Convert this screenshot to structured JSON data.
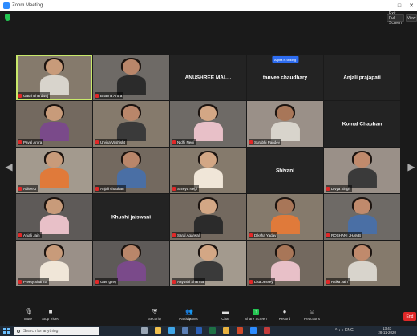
{
  "window": {
    "title": "Zoom Meeting",
    "controls": [
      "—",
      "□",
      "✕"
    ]
  },
  "top": {
    "exit_label": "Exit Full Screen",
    "view_label": "View"
  },
  "raise_hand_banner": "Arpita is talking",
  "participants": [
    {
      "name": "Gauri Bhardwaj",
      "video": true,
      "speaking": true
    },
    {
      "name": "Bhavna Arora",
      "video": true
    },
    {
      "name": "ANUSHREE MAL...",
      "video": false,
      "center": "ANUSHREE MAL..."
    },
    {
      "name": "tanvee chaudhary",
      "video": false,
      "center": "tanvee chaudhary"
    },
    {
      "name": "Anjali prajapati",
      "video": false,
      "center": "Anjali prajapati"
    },
    {
      "name": "Payal Arora",
      "video": true
    },
    {
      "name": "Urvika Vashisht",
      "video": true
    },
    {
      "name": "Nidhi Negi",
      "video": true
    },
    {
      "name": "Surabhi Pandey",
      "video": true
    },
    {
      "name": "Komal Chauhan",
      "video": false,
      "center": "Komal Chauhan"
    },
    {
      "name": "Aditee J",
      "video": true
    },
    {
      "name": "Anjali chauhan",
      "video": true
    },
    {
      "name": "Shreya Negi",
      "video": true
    },
    {
      "name": "Shivani",
      "video": false,
      "center": "Shivani"
    },
    {
      "name": "Divya Singh",
      "video": true
    },
    {
      "name": "Anjali Jain",
      "video": true
    },
    {
      "name": "Khushi jaiswani",
      "video": false,
      "center": "Khushi jaiswani"
    },
    {
      "name": "Saral Agarwal",
      "video": true
    },
    {
      "name": "Diksha Yadav",
      "video": true
    },
    {
      "name": "ROSHANI JHAMB",
      "video": true
    },
    {
      "name": "Preety Sharma",
      "video": true
    },
    {
      "name": "Gavi girey",
      "video": true
    },
    {
      "name": "Aayushi Sharma",
      "video": true
    },
    {
      "name": "Lisa Jessey",
      "video": true
    },
    {
      "name": "Ritika Jain",
      "video": true
    }
  ],
  "toolbar": [
    {
      "label": "Mute",
      "icon": "mic-icon"
    },
    {
      "label": "Stop Video",
      "icon": "video-icon"
    },
    {
      "label": "Security",
      "icon": "shield-icon"
    },
    {
      "label": "Participants",
      "icon": "participants-icon"
    },
    {
      "label": "Chat",
      "icon": "chat-icon"
    },
    {
      "label": "Share Screen",
      "icon": "share-icon"
    },
    {
      "label": "Record",
      "icon": "record-icon"
    },
    {
      "label": "Reactions",
      "icon": "reactions-icon"
    }
  ],
  "participants_count": "42",
  "end_label": "End",
  "taskbar": {
    "search_placeholder": "Search for anything",
    "time": "13:43",
    "date": "28-11-2020"
  },
  "colors": {
    "speaking_border": "#c8e86b",
    "share_green": "#23c552",
    "end_red": "#e02828"
  }
}
